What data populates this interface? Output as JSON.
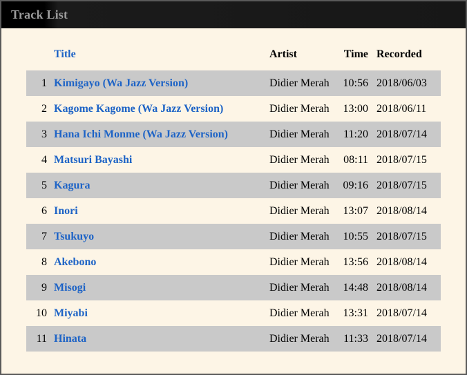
{
  "page": {
    "title": "Track List"
  },
  "colors": {
    "background": "#FDF5E6",
    "topbar_background": "#171717",
    "topbar_text": "#9C9C9C",
    "stripe_row": "#C9C9C9",
    "link_blue": "#1D63C6",
    "window_border": "#5A5A5A"
  },
  "table": {
    "headers": {
      "number": "",
      "title": "Title",
      "artist": "Artist",
      "time": "Time",
      "recorded": "Recorded"
    },
    "rows": [
      {
        "number": "1",
        "title": "Kimigayo (Wa Jazz Version)",
        "artist": "Didier Merah",
        "time": "10:56",
        "recorded": "2018/06/03"
      },
      {
        "number": "2",
        "title": "Kagome Kagome (Wa Jazz Version)",
        "artist": "Didier Merah",
        "time": "13:00",
        "recorded": "2018/06/11"
      },
      {
        "number": "3",
        "title": "Hana Ichi Monme (Wa Jazz Version)",
        "artist": "Didier Merah",
        "time": "11:20",
        "recorded": "2018/07/14"
      },
      {
        "number": "4",
        "title": "Matsuri Bayashi",
        "artist": "Didier Merah",
        "time": "08:11",
        "recorded": "2018/07/15"
      },
      {
        "number": "5",
        "title": "Kagura",
        "artist": "Didier Merah",
        "time": "09:16",
        "recorded": "2018/07/15"
      },
      {
        "number": "6",
        "title": "Inori",
        "artist": "Didier Merah",
        "time": "13:07",
        "recorded": "2018/08/14"
      },
      {
        "number": "7",
        "title": "Tsukuyo",
        "artist": "Didier Merah",
        "time": "10:55",
        "recorded": "2018/07/15"
      },
      {
        "number": "8",
        "title": "Akebono",
        "artist": "Didier Merah",
        "time": "13:56",
        "recorded": "2018/08/14"
      },
      {
        "number": "9",
        "title": "Misogi",
        "artist": "Didier Merah",
        "time": "14:48",
        "recorded": "2018/08/14"
      },
      {
        "number": "10",
        "title": "Miyabi",
        "artist": "Didier Merah",
        "time": "13:31",
        "recorded": "2018/07/14"
      },
      {
        "number": "11",
        "title": "Hinata",
        "artist": "Didier Merah",
        "time": "11:33",
        "recorded": "2018/07/14"
      }
    ]
  }
}
